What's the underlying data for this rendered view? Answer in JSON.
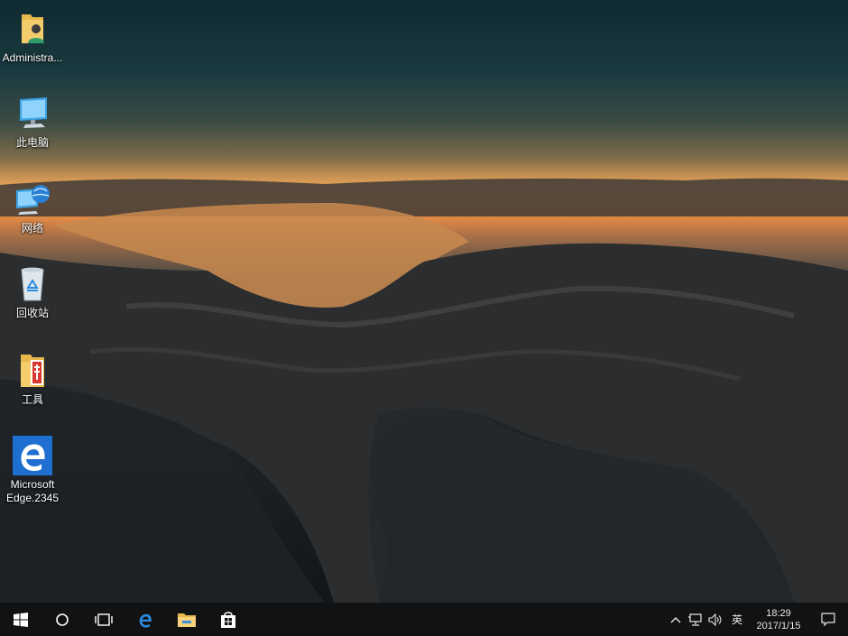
{
  "desktop": {
    "icons": [
      {
        "label": "Administra...",
        "icon": "user-folder-icon"
      },
      {
        "label": "此电脑",
        "icon": "computer-icon"
      },
      {
        "label": "网络",
        "icon": "network-icon"
      },
      {
        "label": "回收站",
        "icon": "recycle-bin-icon"
      },
      {
        "label": "工具",
        "icon": "tools-folder-icon"
      },
      {
        "label": "Microsoft\nEdge.2345",
        "icon": "edge-icon"
      }
    ]
  },
  "taskbar": {
    "apps": [
      "start-icon",
      "search-circle-icon",
      "task-view-icon",
      "edge-icon",
      "file-explorer-icon",
      "store-icon"
    ],
    "tray": {
      "ime": "英",
      "time": "18:29",
      "date": "2017/1/15"
    }
  },
  "colors": {
    "taskbar_bg": "#101214",
    "edge_blue": "#1e6fd0",
    "accent_orange": "#f2a95a"
  }
}
